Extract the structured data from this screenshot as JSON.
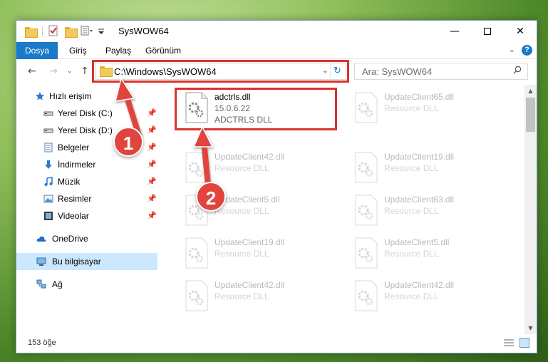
{
  "window": {
    "title": "SysWOW64",
    "minimize": "—",
    "close": "✕"
  },
  "ribbon": {
    "tabs": [
      "Dosya",
      "Giriş",
      "Paylaş",
      "Görünüm"
    ],
    "help": "?"
  },
  "address": {
    "path": "C:\\Windows\\SysWOW64",
    "search_placeholder": "Ara: SysWOW64"
  },
  "sidebar": {
    "items": [
      {
        "label": "Hızlı erişim",
        "icon": "star-icon",
        "pinned": false
      },
      {
        "label": "Yerel Disk (C:)",
        "icon": "drive-icon",
        "pinned": true
      },
      {
        "label": "Yerel Disk (D:)",
        "icon": "drive-icon",
        "pinned": true
      },
      {
        "label": "Belgeler",
        "icon": "documents-icon",
        "pinned": true
      },
      {
        "label": "İndirmeler",
        "icon": "download-icon",
        "pinned": true
      },
      {
        "label": "Müzik",
        "icon": "music-icon",
        "pinned": true
      },
      {
        "label": "Resimler",
        "icon": "pictures-icon",
        "pinned": true
      },
      {
        "label": "Videolar",
        "icon": "video-icon",
        "pinned": true
      },
      {
        "label": "OneDrive",
        "icon": "cloud-icon",
        "pinned": false
      },
      {
        "label": "Bu bilgisayar",
        "icon": "computer-icon",
        "pinned": false,
        "selected": true
      },
      {
        "label": "Ağ",
        "icon": "network-icon",
        "pinned": false
      }
    ]
  },
  "files": {
    "highlighted": {
      "name": "adctrls.dll",
      "version": "15.0.6.22",
      "type": "ADCTRLS DLL"
    },
    "faded_left": [
      {
        "name": "UpdateClient42.dll",
        "type": "Resource DLL"
      },
      {
        "name": "UpdateClient5.dll",
        "type": "Resource DLL"
      },
      {
        "name": "UpdateClient19.dll",
        "type": "Resource DLL"
      },
      {
        "name": "UpdateClient42.dll",
        "type": "Resource DLL"
      }
    ],
    "faded_right": [
      {
        "name": "UpdateClient65.dll",
        "type": "Resource DLL"
      },
      {
        "name": "UpdateClient19.dll",
        "type": "Resource DLL"
      },
      {
        "name": "UpdateClient63.dll",
        "type": "Resource DLL"
      },
      {
        "name": "UpdateClient5.dll",
        "type": "Resource DLL"
      },
      {
        "name": "UpdateClient42.dll",
        "type": "Resource DLL"
      }
    ]
  },
  "status": {
    "count": "153 öğe"
  },
  "annotations": {
    "step1": "1",
    "step2": "2",
    "color": "#e0443c"
  },
  "colors": {
    "accent": "#1979ca",
    "highlight_border": "#d9322c",
    "selected_bg": "#cce8ff"
  }
}
